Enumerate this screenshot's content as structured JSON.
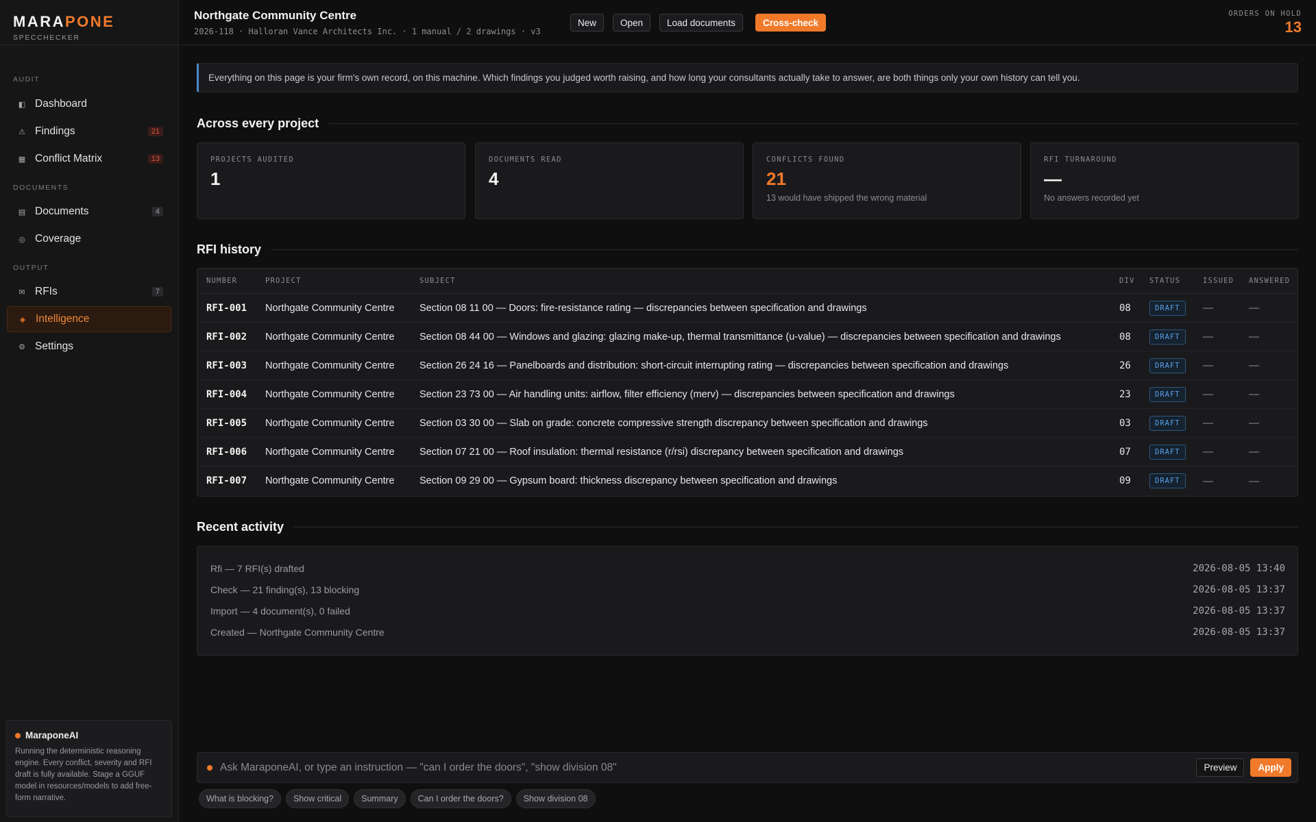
{
  "brand": {
    "name_a": "MARA",
    "name_b": "PONE",
    "sub": "SPECCHECKER"
  },
  "sidebar": {
    "sections": {
      "audit": "AUDIT",
      "documents": "DOCUMENTS",
      "output": "OUTPUT"
    },
    "items": [
      {
        "label": "Dashboard",
        "icon": "dashboard-icon",
        "badge": ""
      },
      {
        "label": "Findings",
        "icon": "warning-icon",
        "badge": "21"
      },
      {
        "label": "Conflict Matrix",
        "icon": "grid-icon",
        "badge": "13"
      },
      {
        "label": "Documents",
        "icon": "document-icon",
        "badge": "4"
      },
      {
        "label": "Coverage",
        "icon": "coverage-icon",
        "badge": ""
      },
      {
        "label": "RFIs",
        "icon": "mail-icon",
        "badge": "7"
      },
      {
        "label": "Intelligence",
        "icon": "diamond-icon",
        "badge": ""
      },
      {
        "label": "Settings",
        "icon": "gear-icon",
        "badge": ""
      }
    ],
    "ai": {
      "title": "MaraponeAI",
      "text": "Running the deterministic reasoning engine. Every conflict, severity and RFI draft is fully available. Stage a GGUF model in resources/models to add free-form narrative."
    }
  },
  "header": {
    "title": "Northgate Community Centre",
    "meta": "2026-118 · Halloran Vance Architects Inc. · 1 manual / 2 drawings · v3",
    "buttons": {
      "new": "New",
      "open": "Open",
      "load": "Load documents",
      "cross": "Cross-check"
    },
    "hold_label": "ORDERS ON HOLD",
    "hold_count": "13"
  },
  "notice": "Everything on this page is your firm's own record, on this machine. Which findings you judged worth raising, and how long your consultants actually take to answer, are both things only your own history can tell you.",
  "across": {
    "title": "Across every project",
    "cards": [
      {
        "label": "PROJECTS AUDITED",
        "value": "1",
        "note": ""
      },
      {
        "label": "DOCUMENTS READ",
        "value": "4",
        "note": ""
      },
      {
        "label": "CONFLICTS FOUND",
        "value": "21",
        "note": "13 would have shipped the wrong material"
      },
      {
        "label": "RFI TURNAROUND",
        "value": "—",
        "note": "No answers recorded yet"
      }
    ]
  },
  "rfi": {
    "title": "RFI history",
    "columns": {
      "number": "NUMBER",
      "project": "PROJECT",
      "subject": "SUBJECT",
      "div": "DIV",
      "status": "STATUS",
      "issued": "ISSUED",
      "answered": "ANSWERED"
    },
    "rows": [
      {
        "number": "RFI-001",
        "project": "Northgate Community Centre",
        "subject": "Section 08 11 00 — Doors: fire-resistance rating — discrepancies between specification and drawings",
        "div": "08",
        "status": "DRAFT",
        "issued": "—",
        "answered": "—"
      },
      {
        "number": "RFI-002",
        "project": "Northgate Community Centre",
        "subject": "Section 08 44 00 — Windows and glazing: glazing make-up, thermal transmittance (u-value) — discrepancies between specification and drawings",
        "div": "08",
        "status": "DRAFT",
        "issued": "—",
        "answered": "—"
      },
      {
        "number": "RFI-003",
        "project": "Northgate Community Centre",
        "subject": "Section 26 24 16 — Panelboards and distribution: short-circuit interrupting rating — discrepancies between specification and drawings",
        "div": "26",
        "status": "DRAFT",
        "issued": "—",
        "answered": "—"
      },
      {
        "number": "RFI-004",
        "project": "Northgate Community Centre",
        "subject": "Section 23 73 00 — Air handling units: airflow, filter efficiency (merv) — discrepancies between specification and drawings",
        "div": "23",
        "status": "DRAFT",
        "issued": "—",
        "answered": "—"
      },
      {
        "number": "RFI-005",
        "project": "Northgate Community Centre",
        "subject": "Section 03 30 00 — Slab on grade: concrete compressive strength discrepancy between specification and drawings",
        "div": "03",
        "status": "DRAFT",
        "issued": "—",
        "answered": "—"
      },
      {
        "number": "RFI-006",
        "project": "Northgate Community Centre",
        "subject": "Section 07 21 00 — Roof insulation: thermal resistance (r/rsi) discrepancy between specification and drawings",
        "div": "07",
        "status": "DRAFT",
        "issued": "—",
        "answered": "—"
      },
      {
        "number": "RFI-007",
        "project": "Northgate Community Centre",
        "subject": "Section 09 29 00 — Gypsum board: thickness discrepancy between specification and drawings",
        "div": "09",
        "status": "DRAFT",
        "issued": "—",
        "answered": "—"
      }
    ]
  },
  "activity": {
    "title": "Recent activity",
    "items": [
      {
        "text": "Rfi — 7 RFI(s) drafted",
        "time": "2026-08-05 13:40"
      },
      {
        "text": "Check — 21 finding(s), 13 blocking",
        "time": "2026-08-05 13:37"
      },
      {
        "text": "Import — 4 document(s), 0 failed",
        "time": "2026-08-05 13:37"
      },
      {
        "text": "Created — Northgate Community Centre",
        "time": "2026-08-05 13:37"
      }
    ]
  },
  "ask": {
    "placeholder": "Ask MaraponeAI, or type an instruction — \"can I order the doors\", \"show division 08\"",
    "preview": "Preview",
    "apply": "Apply",
    "chips": [
      "What is blocking?",
      "Show critical",
      "Summary",
      "Can I order the doors?",
      "Show division 08"
    ]
  },
  "colors": {
    "accent": "#f07a2a",
    "info": "#4b87c9",
    "danger": "#e0563b",
    "draft": "#5aa0e8"
  }
}
